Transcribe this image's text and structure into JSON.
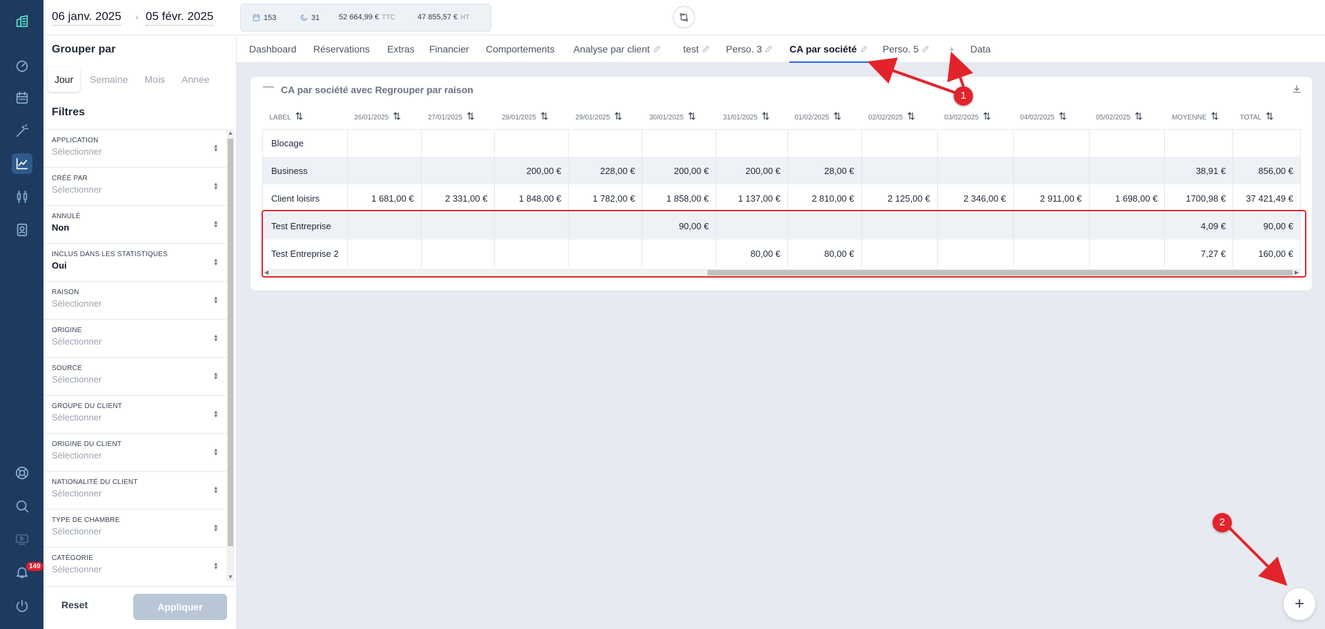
{
  "topbar": {
    "date_start": "06 janv. 2025",
    "date_sep": "›",
    "date_end": "05 févr. 2025",
    "stats": [
      {
        "icon": "calendar-icon",
        "value": "153",
        "unit": ""
      },
      {
        "icon": "moon-icon",
        "value": "31",
        "unit": ""
      },
      {
        "icon": "",
        "value": "52 664,99 €",
        "unit": "TTC"
      },
      {
        "icon": "",
        "value": "47 855,57 €",
        "unit": "HT"
      }
    ]
  },
  "nav": {
    "notifications_count": "149"
  },
  "sidebar": {
    "group_title": "Grouper par",
    "group_options": [
      "Jour",
      "Semaine",
      "Mois",
      "Année"
    ],
    "selected_group": "Jour",
    "filters_title": "Filtres",
    "filters": [
      {
        "label": "APPLICATION",
        "value": "Sélectionner",
        "set": false
      },
      {
        "label": "CRÉÉ PAR",
        "value": "Sélectionner",
        "set": false
      },
      {
        "label": "ANNULÉ",
        "value": "Non",
        "set": true
      },
      {
        "label": "INCLUS DANS LES STATISTIQUES",
        "value": "Oui",
        "set": true
      },
      {
        "label": "RAISON",
        "value": "Sélectionner",
        "set": false
      },
      {
        "label": "ORIGINE",
        "value": "Sélectionner",
        "set": false
      },
      {
        "label": "SOURCE",
        "value": "Sélectionner",
        "set": false
      },
      {
        "label": "GROUPE DU CLIENT",
        "value": "Sélectionner",
        "set": false
      },
      {
        "label": "ORIGINE DU CLIENT",
        "value": "Sélectionner",
        "set": false
      },
      {
        "label": "NATIONALITÉ DU CLIENT",
        "value": "Sélectionner",
        "set": false
      },
      {
        "label": "TYPE DE CHAMBRE",
        "value": "Sélectionner",
        "set": false
      },
      {
        "label": "CATÉGORIE",
        "value": "Sélectionner",
        "set": false
      }
    ],
    "reset_label": "Reset",
    "apply_label": "Appliquer"
  },
  "tabs": {
    "items": [
      "Dashboard",
      "Réservations",
      "Extras",
      "Financier",
      "Comportements",
      "Analyse par client",
      "test",
      "Perso. 3",
      "CA par société",
      "Perso. 5",
      "+",
      "Data"
    ],
    "active": "CA par société"
  },
  "card": {
    "title": "CA par société avec Regrouper par raison",
    "columns": [
      "LABEL",
      "26/01/2025",
      "27/01/2025",
      "28/01/2025",
      "29/01/2025",
      "30/01/2025",
      "31/01/2025",
      "01/02/2025",
      "02/02/2025",
      "03/02/2025",
      "04/02/2025",
      "05/02/2025",
      "MOYENNE",
      "TOTAL"
    ],
    "rows": [
      [
        "Blocage",
        "",
        "",
        "",
        "",
        "",
        "",
        "",
        "",
        "",
        "",
        "",
        "",
        ""
      ],
      [
        "Business",
        "",
        "",
        "200,00 €",
        "228,00 €",
        "200,00 €",
        "200,00 €",
        "28,00 €",
        "",
        "",
        "",
        "",
        "38,91 €",
        "856,00 €"
      ],
      [
        "Client loisirs",
        "1 681,00 €",
        "2 331,00 €",
        "1 848,00 €",
        "1 782,00 €",
        "1 858,00 €",
        "1 137,00 €",
        "2 810,00 €",
        "2 125,00 €",
        "2 346,00 €",
        "2 911,00 €",
        "1 698,00 €",
        "1700,98 €",
        "37 421,49 €"
      ],
      [
        "Test Entreprise",
        "",
        "",
        "",
        "",
        "90,00 €",
        "",
        "",
        "",
        "",
        "",
        "",
        "4,09 €",
        "90,00 €"
      ],
      [
        "Test Entreprise 2",
        "",
        "",
        "",
        "",
        "",
        "80,00 €",
        "80,00 €",
        "",
        "",
        "",
        "",
        "7,27 €",
        "160,00 €"
      ]
    ]
  },
  "annotations": {
    "marker1": "1",
    "marker2": "2"
  },
  "fab": {
    "label": "+"
  },
  "colors": {
    "rail": "#1e3a5f",
    "accent": "#2563eb",
    "annotation": "#e3232b"
  }
}
